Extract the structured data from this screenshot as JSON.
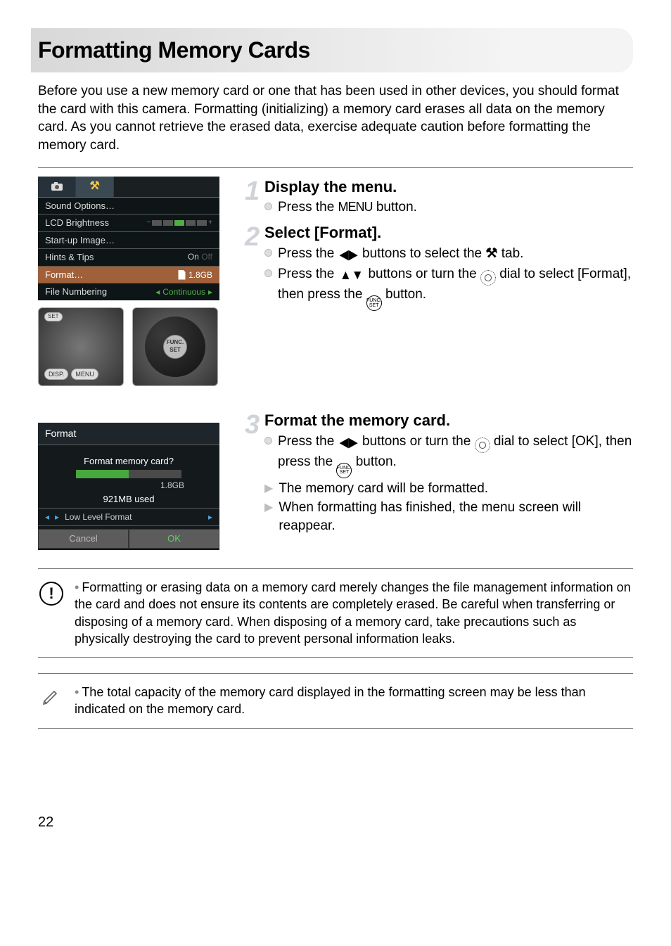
{
  "page": {
    "title": "Formatting Memory Cards",
    "intro": "Before you use a new memory card or one that has been used in other devices, you should format the card with this camera. Formatting (initializing) a memory card erases all data on the memory card. As you cannot retrieve the erased data, exercise adequate caution before formatting the memory card.",
    "page_number": "22"
  },
  "menu_screenshot": {
    "rows": {
      "sound_options": "Sound Options…",
      "lcd_brightness": "LCD Brightness",
      "startup_image": "Start-up Image…",
      "hints_tips": "Hints & Tips",
      "hints_tips_val": "On",
      "format": "Format…",
      "format_val": "1.8GB",
      "file_numbering": "File Numbering",
      "file_numbering_val": "Continuous"
    }
  },
  "controls": {
    "disp": "DISP.",
    "menu": "MENU",
    "set": "SET",
    "func": "FUNC.",
    "func_set": "SET"
  },
  "format_screenshot": {
    "title": "Format",
    "prompt": "Format memory card?",
    "capacity": "1.8GB",
    "used": "921MB used",
    "low_level": "Low Level Format",
    "cancel": "Cancel",
    "ok": "OK"
  },
  "steps": {
    "s1": {
      "num": "1",
      "title": "Display the menu.",
      "l1a": "Press the ",
      "l1b": " button.",
      "menu_word": "MENU"
    },
    "s2": {
      "num": "2",
      "title": "Select [Format].",
      "l1a": "Press the ",
      "l1b": " buttons to select the ",
      "l1c": " tab.",
      "l2a": "Press the ",
      "l2b": " buttons or turn the ",
      "l2c": " dial to select [Format], then press the ",
      "l2d": " button."
    },
    "s3": {
      "num": "3",
      "title": "Format the memory card.",
      "l1a": "Press the ",
      "l1b": " buttons or turn the ",
      "l1c": " dial to select [OK], then press the ",
      "l1d": " button.",
      "l2": "The memory card will be formatted.",
      "l3": "When formatting has finished, the menu screen will reappear."
    }
  },
  "notes": {
    "caution": "Formatting or erasing data on a memory card merely changes the file management information on the card and does not ensure its contents are completely erased. Be careful when transferring or disposing of a memory card. When disposing of a memory card, take precautions such as physically destroying the card to prevent personal information leaks.",
    "tip": "The total capacity of the memory card displayed in the formatting screen may be less than indicated on the memory card."
  },
  "icons": {
    "camera": "camera-icon",
    "tools": "tools-icon",
    "left_right": "◀▶",
    "up_down": "▲▼"
  }
}
